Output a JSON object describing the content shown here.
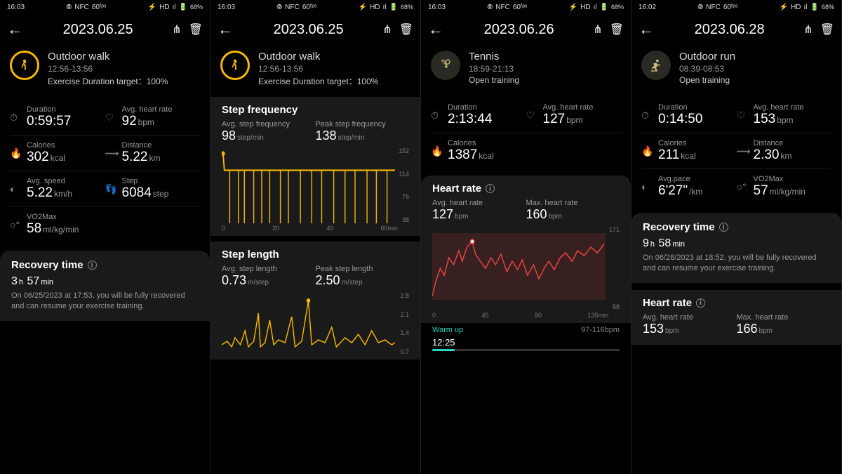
{
  "screens": [
    {
      "status_time": "16:03",
      "status_nfc": "NFC",
      "status_fps": "60ᶠᵖˢ",
      "status_hd": "HD",
      "status_signal": "ıl",
      "status_battery": "68%",
      "date": "2023.06.25",
      "activity": "Outdoor walk",
      "time_range": "12:56-13:56",
      "target": "Exercise Duration target：100%",
      "metrics": {
        "duration_lbl": "Duration",
        "duration_val": "0:59:57",
        "hr_lbl": "Avg. heart rate",
        "hr_val": "92",
        "hr_unit": "bpm",
        "cal_lbl": "Calories",
        "cal_val": "302",
        "cal_unit": "kcal",
        "dist_lbl": "Distance",
        "dist_val": "5.22",
        "dist_unit": "km",
        "speed_lbl": "Avg. speed",
        "speed_val": "5.22",
        "speed_unit": "km/h",
        "step_lbl": "Step",
        "step_val": "6084",
        "step_unit": "step",
        "vo2_lbl": "VO2Max",
        "vo2_val": "58",
        "vo2_unit": "ml/kg/min"
      },
      "recovery_title": "Recovery time",
      "recovery_h": "3",
      "recovery_hu": "h",
      "recovery_m": "57",
      "recovery_mu": "min",
      "recovery_text": "On 06/25/2023 at 17:53, you will be fully recovered and can resume your exercise training."
    },
    {
      "status_time": "16:03",
      "status_nfc": "NFC",
      "status_fps": "60ᶠᵖˢ",
      "status_hd": "HD",
      "status_signal": "ıl",
      "status_battery": "68%",
      "date": "2023.06.25",
      "activity": "Outdoor walk",
      "time_range": "12:56-13:56",
      "target": "Exercise Duration target：100%",
      "stepfreq_title": "Step frequency",
      "stepfreq_avg_lbl": "Avg. step frequency",
      "stepfreq_avg_val": "98",
      "stepfreq_avg_unit": "step/min",
      "stepfreq_peak_lbl": "Peak step frequency",
      "stepfreq_peak_val": "138",
      "stepfreq_peak_unit": "step/min",
      "steplen_title": "Step length",
      "steplen_avg_lbl": "Avg. step length",
      "steplen_avg_val": "0.73",
      "steplen_avg_unit": "m/step",
      "steplen_peak_lbl": "Peak step length",
      "steplen_peak_val": "2.50",
      "steplen_peak_unit": "m/step"
    },
    {
      "status_time": "16:03",
      "status_nfc": "NFC",
      "status_fps": "60ᶠᵖˢ",
      "status_hd": "HD",
      "status_signal": "ıl",
      "status_battery": "68%",
      "date": "2023.06.26",
      "activity": "Tennis",
      "time_range": "18:59-21:13",
      "target": "Open training",
      "metrics": {
        "duration_lbl": "Duration",
        "duration_val": "2:13:44",
        "hr_lbl": "Avg. heart rate",
        "hr_val": "127",
        "hr_unit": "bpm",
        "cal_lbl": "Calories",
        "cal_val": "1387",
        "cal_unit": "kcal"
      },
      "hr_title": "Heart rate",
      "hr_avg_lbl": "Avg. heart rate",
      "hr_avg_val": "127",
      "hr_avg_unit": "bpm",
      "hr_max_lbl": "Max. heart rate",
      "hr_max_val": "160",
      "hr_max_unit": "bpm",
      "warmup_lbl": "Warm up",
      "warmup_time": "12:25",
      "warmup_range": "97-116bpm"
    },
    {
      "status_time": "16:02",
      "status_nfc": "NFC",
      "status_fps": "60ᶠᵖˢ",
      "status_hd": "HD",
      "status_signal": "ıl",
      "status_battery": "68%",
      "date": "2023.06.28",
      "activity": "Outdoor run",
      "time_range": "08:39-08:53",
      "target": "Open training",
      "metrics": {
        "duration_lbl": "Duration",
        "duration_val": "0:14:50",
        "hr_lbl": "Avg. heart rate",
        "hr_val": "153",
        "hr_unit": "bpm",
        "cal_lbl": "Calories",
        "cal_val": "211",
        "cal_unit": "kcal",
        "dist_lbl": "Distance",
        "dist_val": "2.30",
        "dist_unit": "km",
        "pace_lbl": "Avg.pace",
        "pace_val": "6'27\"",
        "pace_unit": "/km",
        "vo2_lbl": "VO2Max",
        "vo2_val": "57",
        "vo2_unit": "ml/kg/min"
      },
      "recovery_title": "Recovery time",
      "recovery_h": "9",
      "recovery_hu": "h",
      "recovery_m": "58",
      "recovery_mu": "min",
      "recovery_text": "On 06/28/2023 at 18:52, you will be fully recovered and can resume your exercise training.",
      "hr_title": "Heart rate",
      "hr_avg_lbl": "Avg. heart rate",
      "hr_avg_val": "153",
      "hr_avg_unit": "bpm",
      "hr_max_lbl": "Max. heart rate",
      "hr_max_val": "166",
      "hr_max_unit": "bpm"
    }
  ],
  "chart_data": [
    {
      "type": "line",
      "title": "Step frequency",
      "xlabel": "min",
      "ylabel": "step/min",
      "xlim": [
        0,
        60
      ],
      "ylim": [
        0,
        152
      ],
      "yticks": [
        38,
        76,
        114,
        152
      ],
      "xticks": [
        0,
        20,
        40,
        "60min"
      ],
      "series": [
        {
          "name": "step_freq",
          "baseline": 105,
          "spikes_to_zero": true
        }
      ]
    },
    {
      "type": "line",
      "title": "Step length",
      "xlabel": "min",
      "ylabel": "m/step",
      "xlim": [
        0,
        60
      ],
      "ylim": [
        0,
        2.8
      ],
      "yticks": [
        0.7,
        1.4,
        2.1,
        2.8
      ],
      "series": [
        {
          "name": "step_length",
          "baseline": 0.75,
          "peaks": [
            1.0,
            2.1,
            1.6,
            2.5,
            1.2
          ]
        }
      ]
    },
    {
      "type": "line",
      "title": "Heart rate (Tennis)",
      "xlabel": "min",
      "ylabel": "bpm",
      "xlim": [
        0,
        135
      ],
      "ylim": [
        58,
        171
      ],
      "yticks": [
        58,
        171
      ],
      "xticks": [
        0,
        45,
        90,
        "135min"
      ],
      "series": [
        {
          "name": "hr",
          "avg": 127,
          "max": 160,
          "min": 58
        }
      ]
    }
  ]
}
